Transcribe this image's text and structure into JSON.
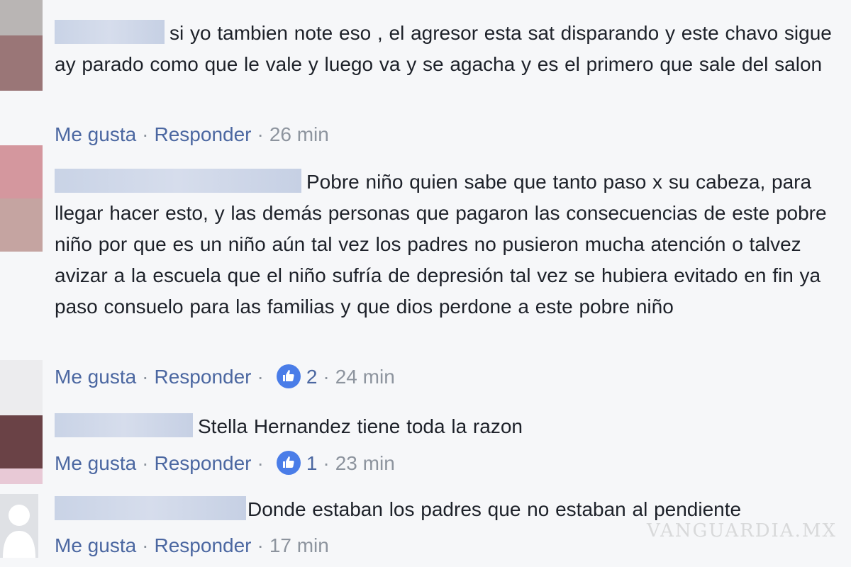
{
  "action_labels": {
    "like": "Me gusta",
    "reply": "Responder",
    "sep": "·"
  },
  "colors": {
    "background": "#f6f7f9",
    "link": "#4b67a1",
    "meta": "#8d949e",
    "text": "#1d2129",
    "like_badge": "#4a7de8"
  },
  "comments": [
    {
      "author": "",
      "text": "si yo tambien note eso , el agresor esta sat disparando y este chavo sigue ay parado como que le vale y luego va y se agacha y es el primero que sale del salon",
      "likes": null,
      "time": "26 min"
    },
    {
      "author": "",
      "text": "Pobre niño quien sabe que tanto paso x su cabeza, para llegar hacer esto, y las demás personas que pagaron las consecuencias de este pobre niño por que es un niño aún tal vez los padres no pusieron mucha atención o talvez avizar a la escuela que el niño sufría de depresión tal vez se hubiera evitado en fin ya paso consuelo para las familias y que dios perdone a este pobre niño",
      "likes": "2",
      "like_icon": "thumbs-up-icon",
      "time": "24 min"
    },
    {
      "author": "",
      "text": "Stella Hernandez tiene toda la razon",
      "likes": "1",
      "like_icon": "thumbs-up-icon",
      "time": "23 min"
    },
    {
      "author": "",
      "text": "Donde estaban los padres que no estaban al pendiente",
      "likes": null,
      "time": "17 min"
    }
  ],
  "watermark": "VANGUARDIA.MX"
}
